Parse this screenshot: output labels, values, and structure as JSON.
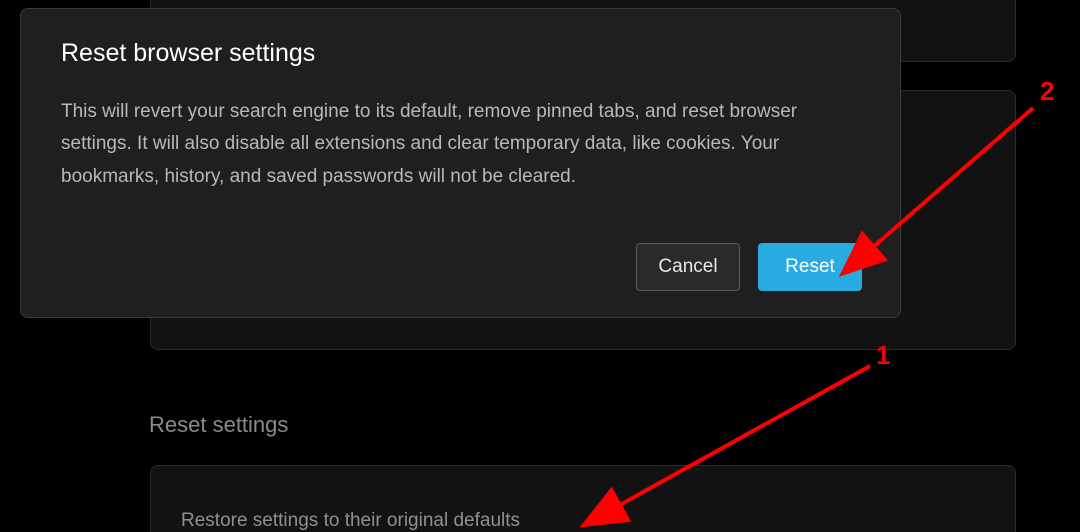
{
  "dialog": {
    "title": "Reset browser settings",
    "body": "This will revert your search engine to its default, remove pinned tabs, and reset browser settings. It will also disable all extensions and clear temporary data, like cookies. Your bookmarks, history, and saved passwords will not be cleared.",
    "cancel_label": "Cancel",
    "reset_label": "Reset"
  },
  "section": {
    "heading": "Reset settings",
    "row_label": "Restore settings to their original defaults"
  },
  "annotations": {
    "label1": "1",
    "label2": "2",
    "color": "#ff0000"
  }
}
